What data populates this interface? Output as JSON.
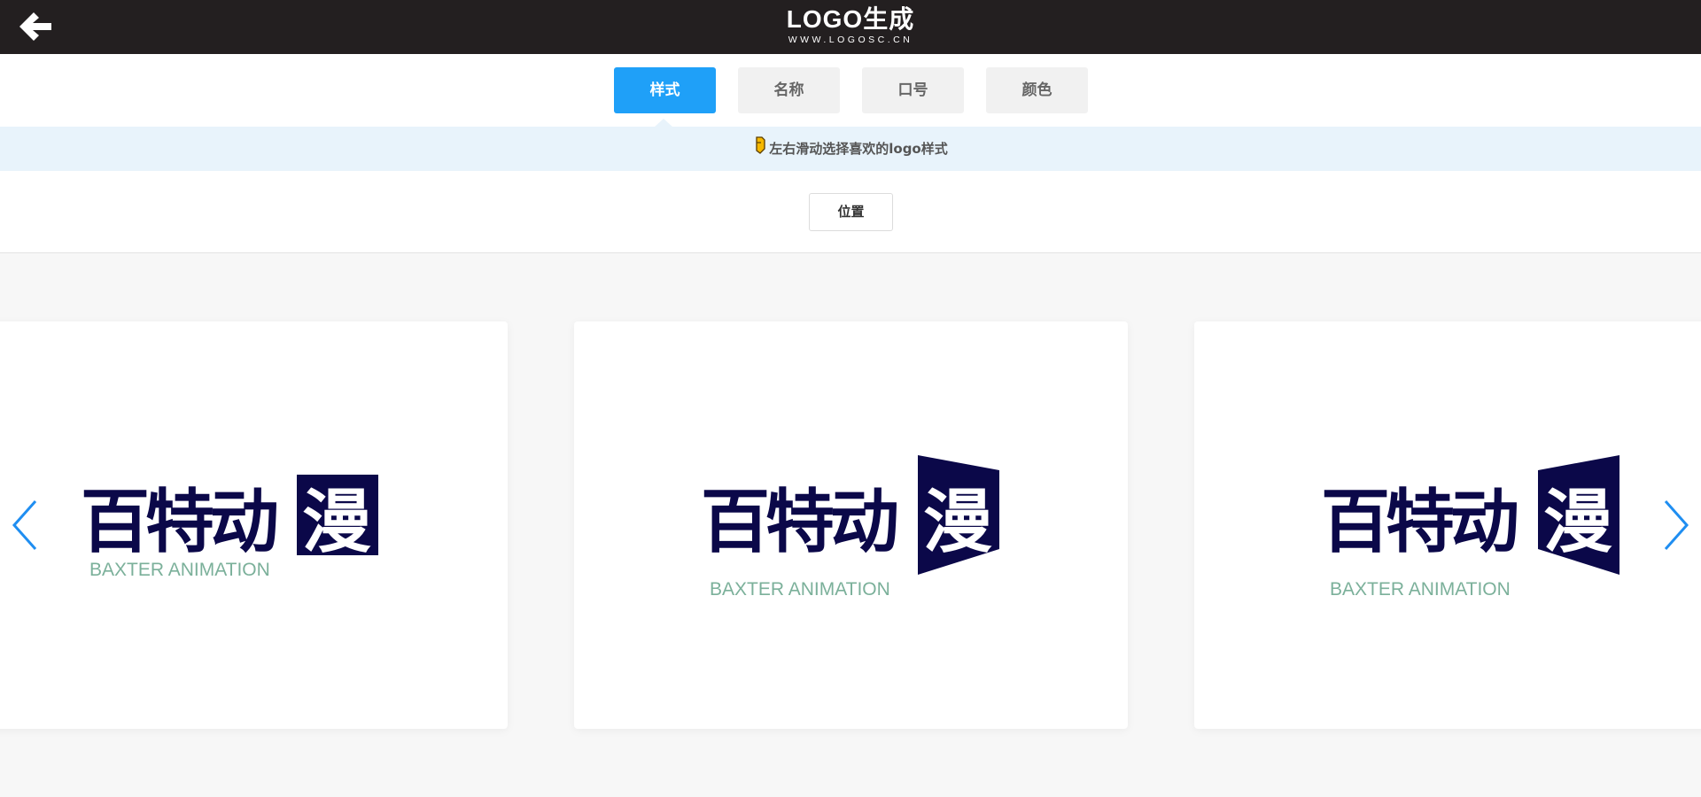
{
  "header": {
    "brand_main": "LOGO生成",
    "brand_sub": "WWW.LOGOSC.CN",
    "back_icon": "arrow-left-icon"
  },
  "tabs": [
    {
      "label": "样式",
      "active": true
    },
    {
      "label": "名称",
      "active": false
    },
    {
      "label": "口号",
      "active": false
    },
    {
      "label": "颜色",
      "active": false
    }
  ],
  "hint": {
    "icon": "pointing-hand-icon",
    "text": "左右滑动选择喜欢的logo样式"
  },
  "position_button": "位置",
  "logo": {
    "name_chars": [
      "百",
      "特",
      "动",
      "漫"
    ],
    "slogan": "BAXTER ANIMATION"
  },
  "colors": {
    "accent": "#1fa0f8",
    "logo_navy": "#0b0849",
    "slogan_green": "#7bb09a",
    "arrow_blue": "#1f8ef1",
    "header_bg": "#231f20"
  },
  "carousel": {
    "prev_icon": "chevron-left-icon",
    "next_icon": "chevron-right-icon"
  }
}
